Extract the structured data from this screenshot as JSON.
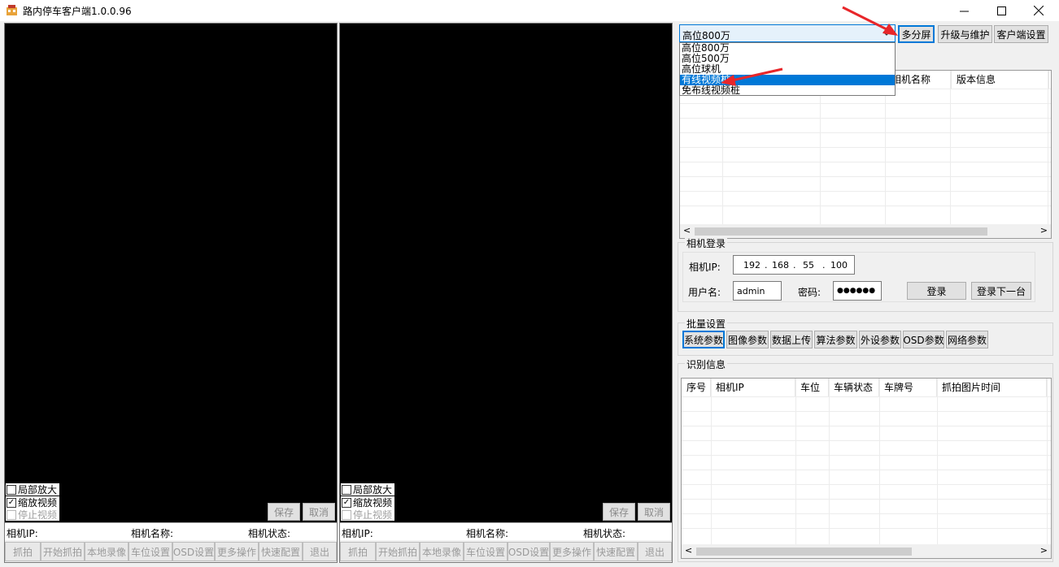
{
  "window": {
    "title": "路内停车客户端1.0.0.96",
    "controls": {
      "minimize": "—",
      "maximize": "☐",
      "close": "✕"
    }
  },
  "video_panes": [
    {
      "checkbox_zoom": "局部放大",
      "checkbox_scale": "缩放视频",
      "checkbox_stop": "停止视频",
      "save": "保存",
      "cancel": "取消",
      "camera_ip_label": "相机IP:",
      "camera_name_label": "相机名称:",
      "camera_status_label": "相机状态:",
      "actions": [
        "抓拍",
        "开始抓拍",
        "本地录像",
        "车位设置",
        "OSD设置",
        "更多操作",
        "快速配置",
        "退出"
      ]
    },
    {
      "checkbox_zoom": "局部放大",
      "checkbox_scale": "缩放视频",
      "checkbox_stop": "停止视频",
      "save": "保存",
      "cancel": "取消",
      "camera_ip_label": "相机IP:",
      "camera_name_label": "相机名称:",
      "camera_status_label": "相机状态:",
      "actions": [
        "抓拍",
        "开始抓拍",
        "本地录像",
        "车位设置",
        "OSD设置",
        "更多操作",
        "快速配置",
        "退出"
      ]
    }
  ],
  "device_type": {
    "selected": "高位800万",
    "options": [
      "高位800万",
      "高位500万",
      "高位球机",
      "有线视频桩",
      "免布线视频桩"
    ],
    "highlighted_index": 3
  },
  "top_buttons": {
    "multi_screen": "多分屏",
    "upgrade": "升级与维护",
    "client_settings": "客户端设置"
  },
  "device_list": {
    "columns": [
      "相机名称",
      "版本信息"
    ]
  },
  "camera_login": {
    "legend": "相机登录",
    "ip_label": "相机IP:",
    "ip": [
      "192",
      "168",
      "55",
      "100"
    ],
    "username_label": "用户名:",
    "username": "admin",
    "password_label": "密码:",
    "password_mask": "●●●●●●",
    "login": "登录",
    "login_next": "登录下一台"
  },
  "batch_settings": {
    "legend": "批量设置",
    "tabs": [
      "系统参数",
      "图像参数",
      "数据上传",
      "算法参数",
      "外设参数",
      "OSD参数",
      "网络参数"
    ]
  },
  "recognition": {
    "legend": "识别信息",
    "columns": [
      "序号",
      "相机IP",
      "车位",
      "车辆状态",
      "车牌号",
      "抓拍图片时间"
    ]
  },
  "colors": {
    "accent": "#0078d7",
    "annotation_arrow": "#e8262a"
  }
}
